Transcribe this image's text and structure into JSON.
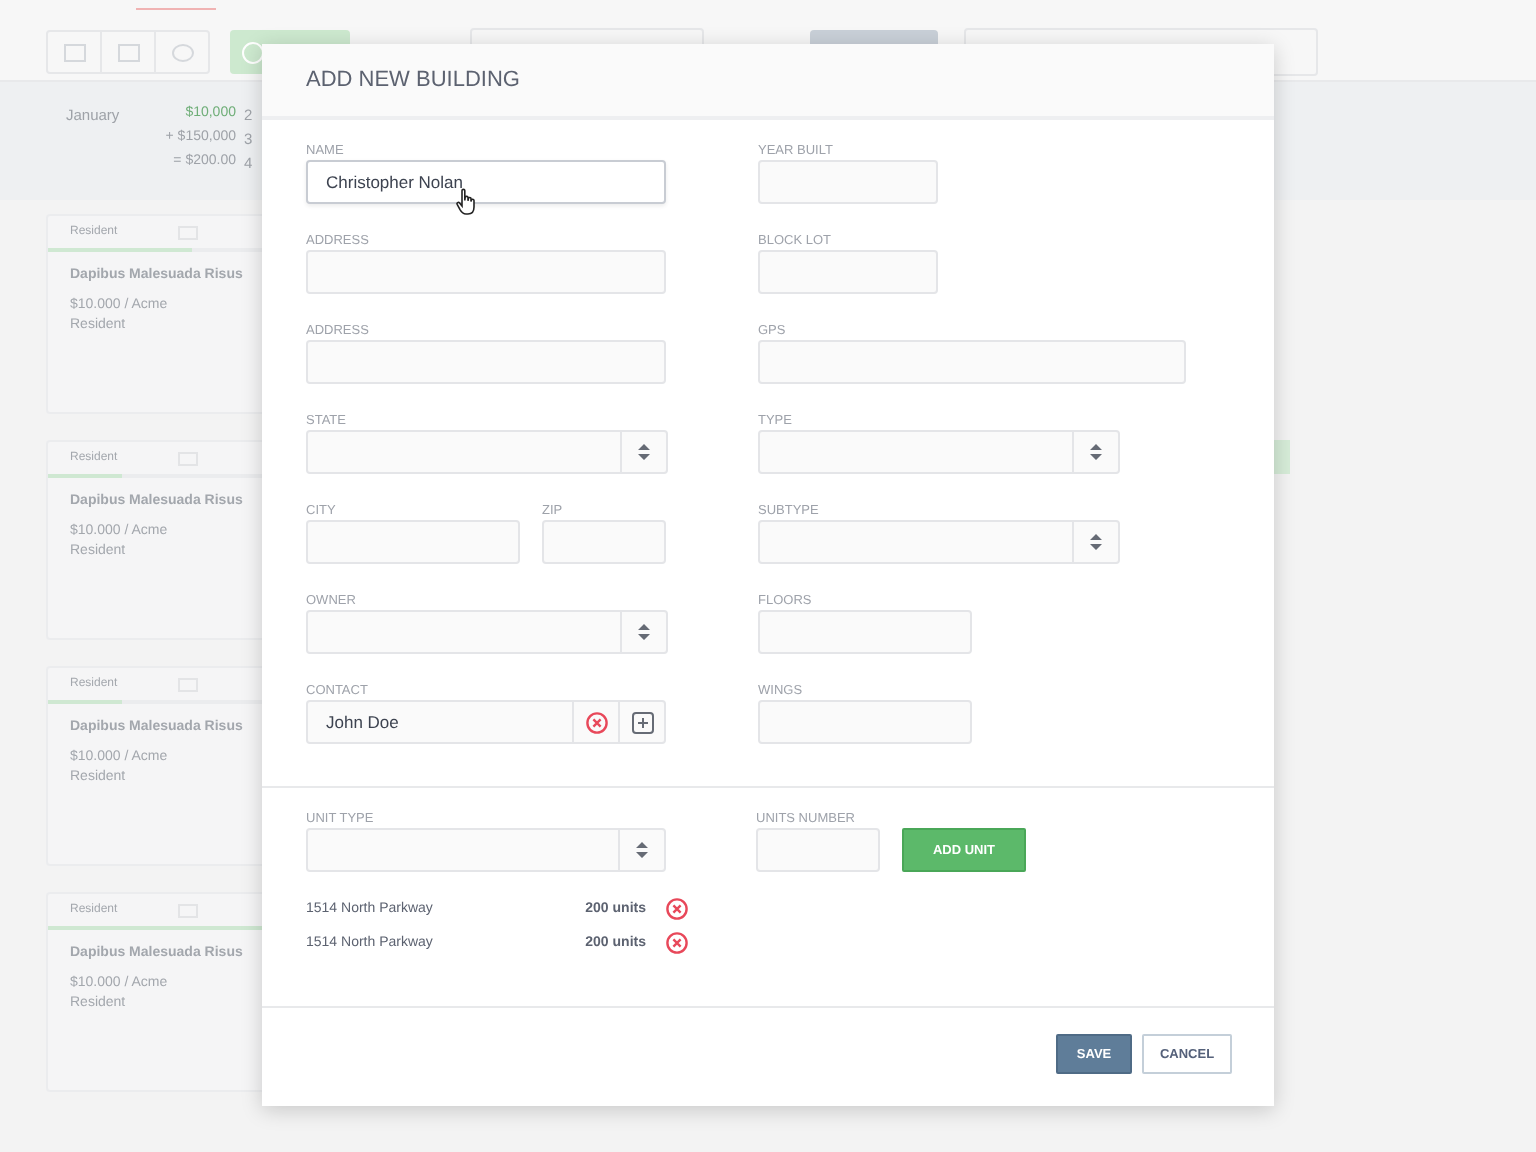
{
  "background": {
    "summary": {
      "month": "January",
      "amounts": [
        "$10,000",
        "+ $150,000",
        "= $200.00"
      ],
      "counts": [
        "2",
        "3",
        "4"
      ]
    },
    "cards": [
      {
        "tag": "Resident",
        "title": "Dapibus Malesuada Risus",
        "price": "$10.000 / Acme",
        "role": "Resident",
        "level": 0.33
      },
      {
        "tag": "Resident",
        "title": "Dapibus Malesuada Risus",
        "price": "$10.000 / Acme",
        "role": "Resident",
        "level": 0.17
      },
      {
        "tag": "Resident",
        "title": "Dapibus Malesuada Risus",
        "price": "$10.000 / Acme",
        "role": "Resident",
        "level": 0.17
      },
      {
        "tag": "Resident",
        "title": "Dapibus Malesuada Risus",
        "price": "$10.000 / Acme",
        "role": "Resident",
        "level": 1
      }
    ]
  },
  "modal": {
    "title": "ADD NEW BUILDING",
    "left_fields": [
      {
        "label": "NAME",
        "kind": "text",
        "value": "Christopher Nolan",
        "focused": true
      },
      {
        "label": "ADDRESS",
        "kind": "text"
      },
      {
        "label": "ADDRESS",
        "kind": "text"
      },
      {
        "label": "STATE",
        "kind": "select"
      },
      {
        "kind": "pair",
        "parts": [
          {
            "label": "CITY"
          },
          {
            "label": "ZIP"
          }
        ]
      },
      {
        "label": "OWNER",
        "kind": "select"
      },
      {
        "label": "CONTACT",
        "kind": "contact",
        "value": "John Doe"
      }
    ],
    "right_fields": [
      {
        "label": "YEAR BUILT",
        "kind": "short"
      },
      {
        "label": "BLOCK LOT",
        "kind": "short"
      },
      {
        "label": "GPS",
        "kind": "wide"
      },
      {
        "label": "TYPE",
        "kind": "select"
      },
      {
        "label": "SUBTYPE",
        "kind": "select"
      },
      {
        "label": "FLOORS",
        "kind": "medium"
      },
      {
        "label": "WINGS",
        "kind": "medium"
      }
    ],
    "unit_type": {
      "label": "UNIT TYPE"
    },
    "units_number": {
      "label": "UNITS NUMBER"
    },
    "add_button": "ADD UNIT",
    "units": [
      {
        "address": "1514 North Parkway",
        "count": "200 units"
      },
      {
        "address": "1514 North Parkway",
        "count": "200 units"
      }
    ],
    "buttons": [
      {
        "label": "SAVE",
        "kind": "primary"
      },
      {
        "label": "CANCEL",
        "kind": "secondary"
      }
    ]
  }
}
